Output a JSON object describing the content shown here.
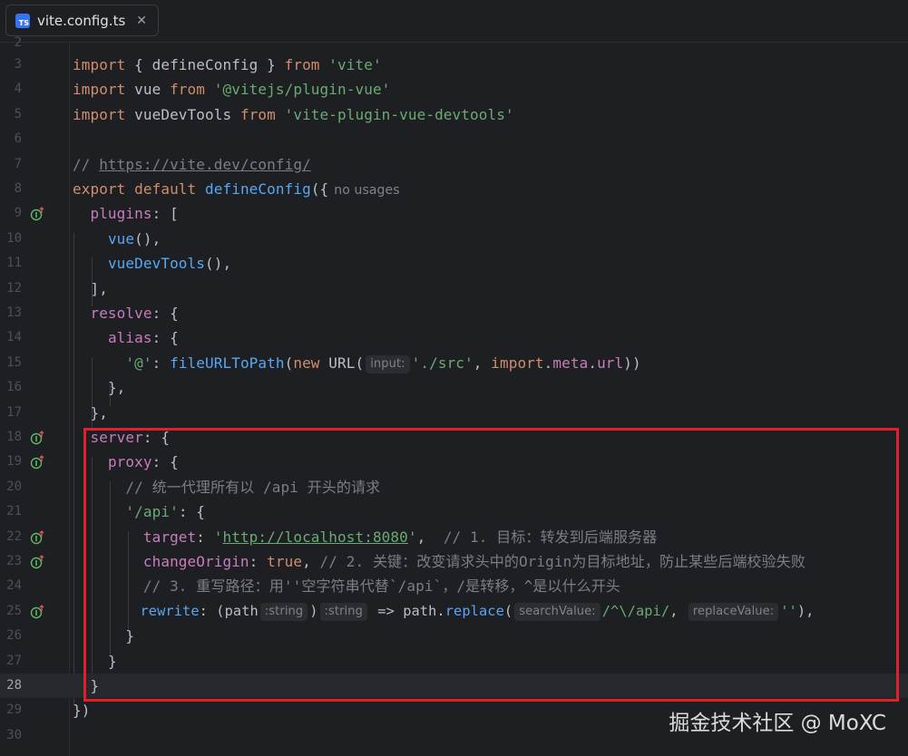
{
  "tab": {
    "icon": "typescript-file-icon",
    "icon_text": "TS",
    "title": "vite.config.ts",
    "close": "✕"
  },
  "colors": {
    "keyword": "#cf8e6d",
    "string": "#6aab73",
    "function": "#56a8f5",
    "property": "#c77dbb",
    "comment": "#7a7e85",
    "highlight_box": "#e0202a"
  },
  "lines": {
    "n2": "2",
    "n3": "3",
    "n4": "4",
    "n5": "5",
    "n6": "6",
    "n7": "7",
    "n8": "8",
    "n9": "9",
    "n10": "10",
    "n11": "11",
    "n12": "12",
    "n13": "13",
    "n14": "14",
    "n15": "15",
    "n16": "16",
    "n17": "17",
    "n18": "18",
    "n19": "19",
    "n20": "20",
    "n21": "21",
    "n22": "22",
    "n23": "23",
    "n24": "24",
    "n25": "25",
    "n26": "26",
    "n27": "27",
    "n28": "28",
    "n29": "29",
    "n30": "30"
  },
  "code": {
    "import": "import",
    "from": "from",
    "l3_open": " { ",
    "l3_name": "defineConfig",
    "l3_close": " } ",
    "l3_str": "'vite'",
    "l4_name": " vue ",
    "l4_str": "'@vitejs/plugin-vue'",
    "l5_name": " vueDevTools ",
    "l5_str": "'vite-plugin-vue-devtools'",
    "l7_prefix": "// ",
    "l7_link": "https://vite.dev/config/",
    "l8_export": "export",
    "l8_default": " default ",
    "l8_fn": "defineConfig",
    "l8_rest": "({",
    "l8_hint": "no usages",
    "plugins": "plugins",
    "l9_rest": ": [",
    "vue": "vue",
    "l10_rest": "(),",
    "vueDevTools": "vueDevTools",
    "l11_rest": "(),",
    "l12": "],",
    "resolve": "resolve",
    "brace_open": ": {",
    "alias": "alias",
    "l15_key": "'@'",
    "l15_colon": ": ",
    "l15_fn": "fileURLToPath",
    "l15_paren": "(",
    "new": "new",
    "l15_url": " URL(",
    "l15_hint": "input:",
    "l15_str": "'./src'",
    "l15_comma": ", ",
    "import_kw": "import",
    "l15_dot1": ".",
    "meta": "meta",
    "l15_dot2": ".",
    "url": "url",
    "l15_end": "))",
    "l16": "},",
    "l17": "},",
    "server": "server",
    "proxy": "proxy",
    "l20_comment": "// 统一代理所有以 /api 开头的请求",
    "l21_key": "'/api'",
    "target": "target",
    "l22_colon": ": ",
    "l22_q1": "'",
    "l22_link": "http://localhost:8080",
    "l22_q2": "'",
    "l22_comma": ",  ",
    "l22_comment": "// 1. 目标：转发到后端服务器",
    "changeOrigin": "changeOrigin",
    "l23_colon": ": ",
    "true": "true",
    "l23_comma": ", ",
    "l23_comment": "// 2. 关键：改变请求头中的Origin为目标地址，防止某些后端校验失败",
    "l24_comment": "// 3. 重写路径：用''空字符串代替`/api`，/是转移，^是以什么开头",
    "rewrite": "rewrite",
    "l25_a": ": (path",
    "l25_hint1": ":string",
    "l25_b": ")",
    "l25_hint2": ":string",
    "l25_c": " => path.",
    "replace": "replace",
    "l25_d": "(",
    "l25_hint3": "searchValue:",
    "l25_regex": "/^\\/api/",
    "l25_e": ", ",
    "l25_hint4": "replaceValue:",
    "l25_str": "''",
    "l25_f": "),",
    "l26": "}",
    "l27": "}",
    "l28": "}",
    "l29": "})"
  },
  "watermark": "掘金技术社区 @ MoXC"
}
